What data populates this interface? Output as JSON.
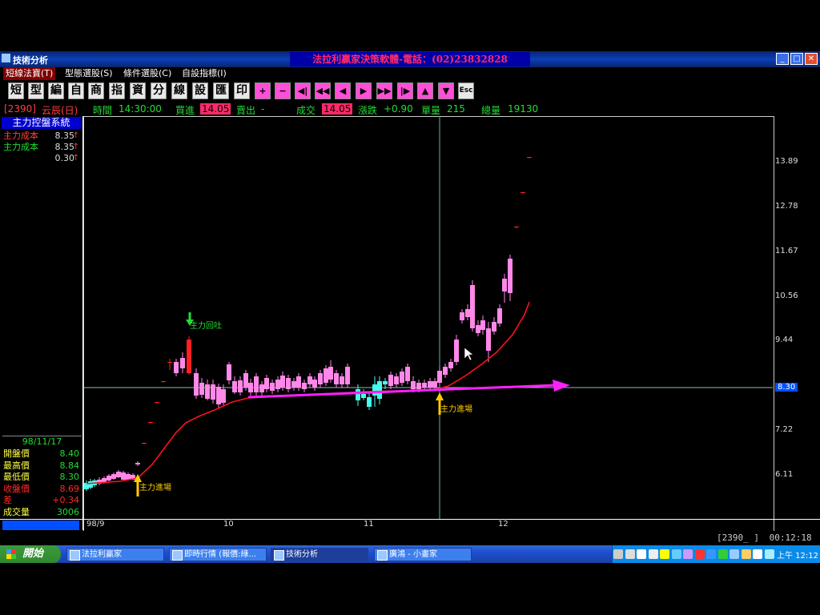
{
  "window": {
    "title": "技術分析",
    "banner": "法拉利贏家決策軟體-電話：(02)23832828",
    "controls": [
      "_",
      "□",
      "✕"
    ]
  },
  "menu": [
    {
      "label": "短線法寶(T)",
      "active": true
    },
    {
      "label": "型態選股(S)",
      "active": false
    },
    {
      "label": "條件選股(C)",
      "active": false
    },
    {
      "label": "自設指標(I)",
      "active": false
    }
  ],
  "toolbar": [
    {
      "label": "短",
      "name": "short-button"
    },
    {
      "label": "型",
      "name": "pattern-button"
    },
    {
      "label": "編",
      "name": "edit-button"
    },
    {
      "label": "自",
      "name": "custom-button"
    },
    {
      "label": "商",
      "name": "product-button"
    },
    {
      "label": "指",
      "name": "indicator-button"
    },
    {
      "label": "資",
      "name": "data-button"
    },
    {
      "label": "分",
      "name": "analysis-button"
    },
    {
      "label": "線",
      "name": "line-button"
    },
    {
      "label": "設",
      "name": "settings-button"
    },
    {
      "label": "匯",
      "name": "export-button"
    },
    {
      "label": "印",
      "name": "print-button"
    },
    {
      "label": "+",
      "name": "zoom-in-button",
      "nav": true
    },
    {
      "label": "−",
      "name": "zoom-out-button",
      "nav": true
    },
    {
      "label": "◀|",
      "name": "first-button",
      "nav": true
    },
    {
      "label": "◀◀",
      "name": "fast-back-button",
      "nav": true
    },
    {
      "label": "◀",
      "name": "back-button",
      "nav": true
    },
    {
      "label": "▶",
      "name": "forward-button",
      "nav": true
    },
    {
      "label": "▶▶",
      "name": "fast-forward-button",
      "nav": true
    },
    {
      "label": "|▶",
      "name": "last-button",
      "nav": true
    },
    {
      "label": "▲",
      "name": "up-button",
      "nav": true
    },
    {
      "label": "▼",
      "name": "down-button",
      "nav": true
    },
    {
      "label": "Esc",
      "name": "esc-button"
    }
  ],
  "info": {
    "code": "[2390]",
    "name": "云辰(日)",
    "time_label": "時間",
    "time": "14:30:00",
    "buy_label": "買進",
    "buy": "14.05",
    "sell_label": "賣出",
    "sell": "-",
    "deal_label": "成交",
    "deal": "14.05",
    "change_label": "漲跌",
    "change": "+0.90",
    "vol_label": "單量",
    "vol": "215",
    "total_label": "總量",
    "total": "19130"
  },
  "left_panel": {
    "title": "主力控盤系統",
    "rows": [
      {
        "label": "主力成本",
        "value": "8.35",
        "arrow": "↑",
        "label_color": "#ff4040"
      },
      {
        "label": "主力成本",
        "value": "8.35",
        "arrow": "↑",
        "label_color": "#22dd33"
      },
      {
        "label": "",
        "value": "0.30",
        "arrow": "↑",
        "label_color": "#ff4040"
      }
    ],
    "date": "98/11/17",
    "ohlc": [
      {
        "label": "開盤價",
        "value": "8.40",
        "color": "#ffff40",
        "vcolor": "#22dd33"
      },
      {
        "label": "最高價",
        "value": "8.84",
        "color": "#ffff40",
        "vcolor": "#22dd33"
      },
      {
        "label": "最低價",
        "value": "8.30",
        "color": "#ffff40",
        "vcolor": "#22dd33"
      },
      {
        "label": "收盤價",
        "value": "8.69",
        "color": "#ff2a2a",
        "vcolor": "#ff2a2a"
      },
      {
        "label": "差",
        "value": "+0.34",
        "color": "#ff2a2a",
        "vcolor": "#ff2a2a"
      },
      {
        "label": "成交量",
        "value": "3006",
        "color": "#ffff40",
        "vcolor": "#22dd33"
      }
    ]
  },
  "chart_data": {
    "type": "candlestick",
    "y_ticks": [
      "13.89",
      "12.78",
      "11.67",
      "10.56",
      "9.44",
      "8.30",
      "7.22",
      "6.11"
    ],
    "current_price_label": "8.30",
    "x_labels": [
      "98/9",
      "10",
      "11",
      "12"
    ],
    "annotations": [
      {
        "text": "主力進場",
        "color": "#ffcc00"
      },
      {
        "text": "主力回吐",
        "color": "#22dd33"
      },
      {
        "text": "主力進場",
        "color": "#ffcc00"
      }
    ],
    "colors": {
      "up": "#ff88e8",
      "down": "#44ffee",
      "limit_up": "#ff2020",
      "ma": "#ff1020",
      "trend": "#ff20ff"
    }
  },
  "status": {
    "code": "[2390_ ]",
    "time": "00:12:18"
  },
  "taskbar": {
    "start": "開始",
    "tasks": [
      {
        "label": "法拉利贏家",
        "active": false
      },
      {
        "label": "即時行情 (報價:綠...",
        "active": false
      },
      {
        "label": "技術分析",
        "active": true
      },
      {
        "label": "廣鴻 - 小畫家",
        "active": false
      }
    ],
    "clock": "上午 12:12"
  }
}
